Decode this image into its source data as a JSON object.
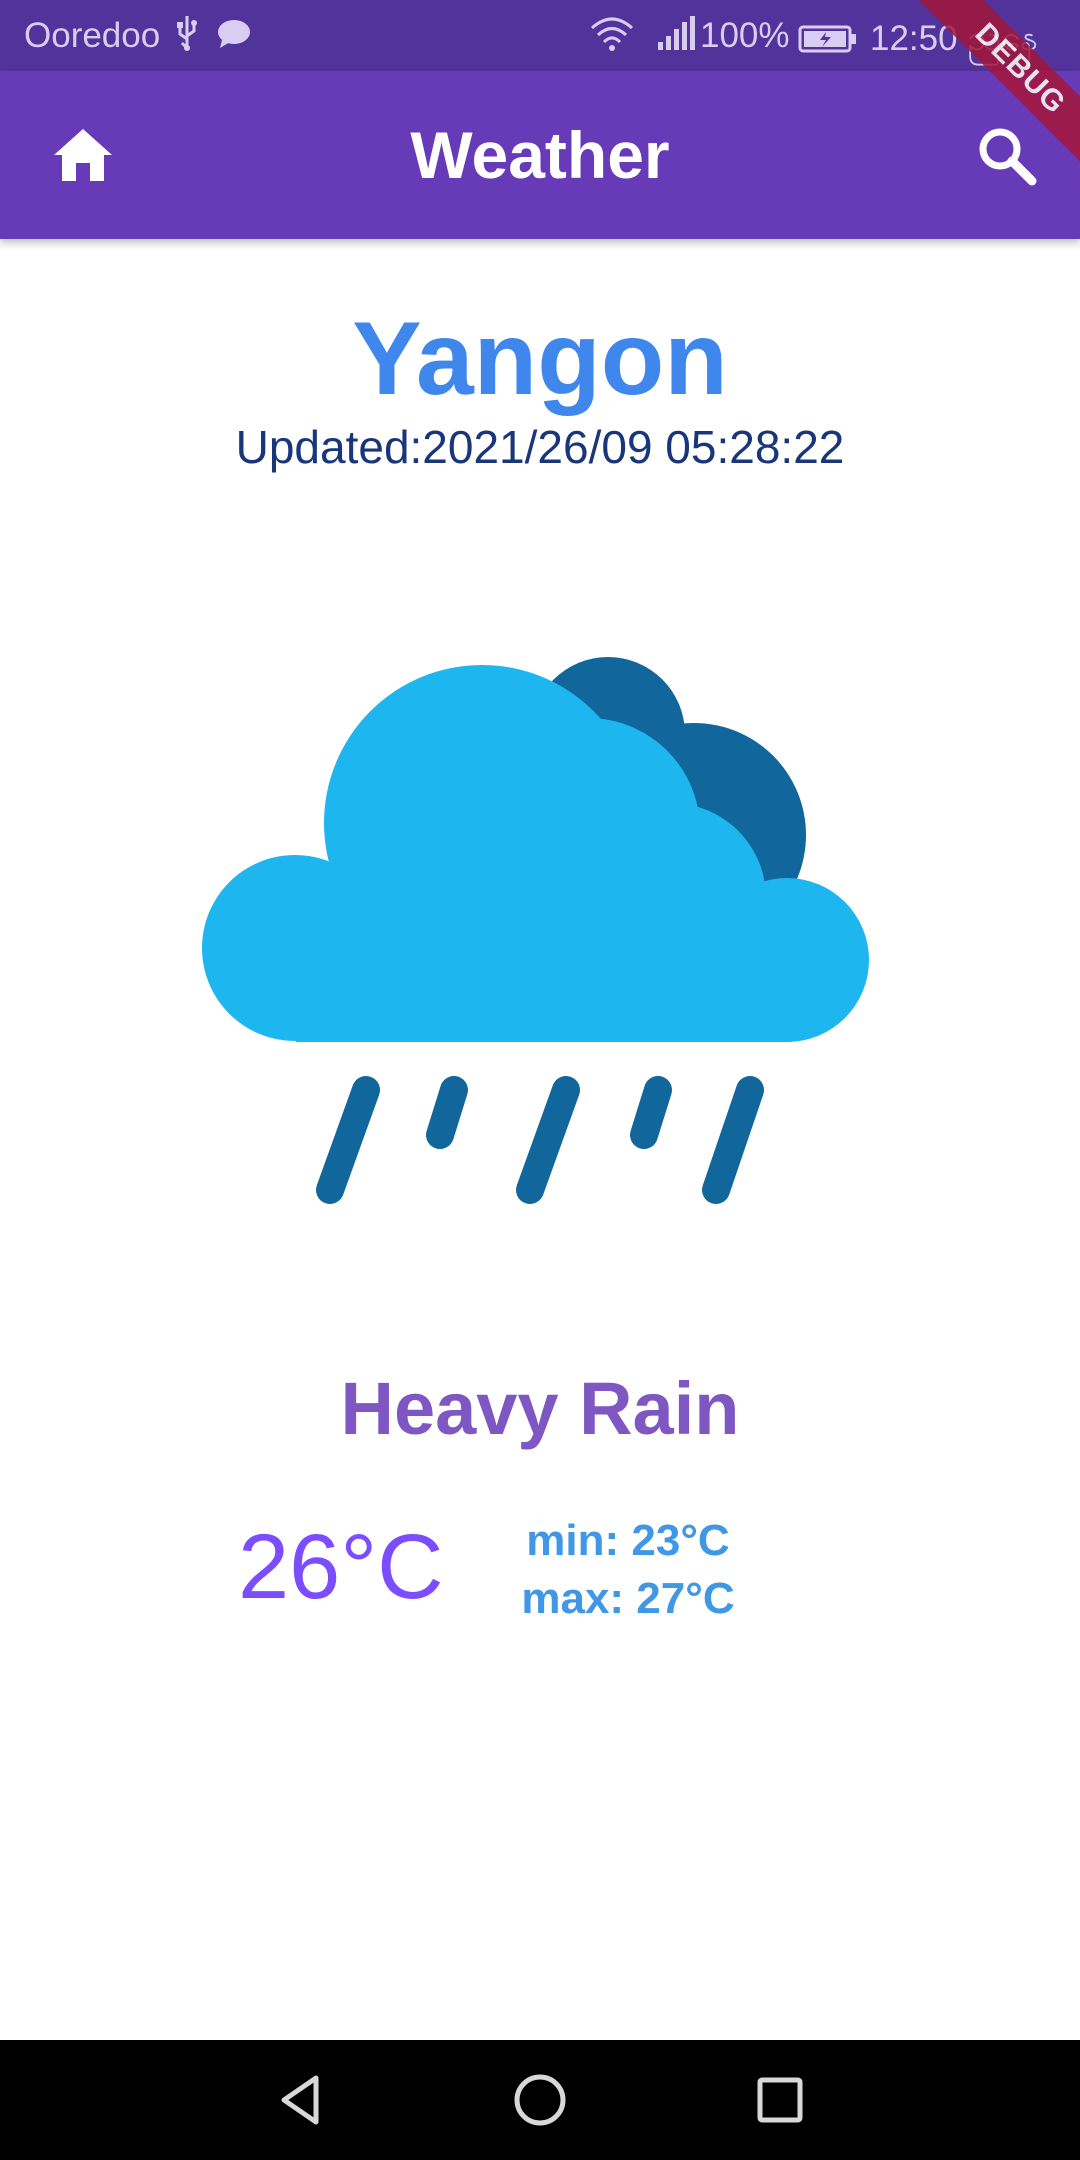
{
  "status_bar": {
    "carrier": "Ooredoo",
    "battery_percent": "100%",
    "time": "12:50 ညနေ"
  },
  "app_bar": {
    "title": "Weather",
    "home_icon": "home-icon",
    "search_icon": "search-icon",
    "color": "#673ab7"
  },
  "debug_banner": {
    "label": "DEBUG"
  },
  "weather": {
    "city": "Yangon",
    "updated": "Updated:2021/26/09 05:28:22",
    "condition": "Heavy Rain",
    "temperature": "26°C",
    "min": "min: 23°C",
    "max": "max: 27°C",
    "icon": "heavy-rain-cloud-icon"
  },
  "colors": {
    "city": "#3f87ed",
    "updated": "#19367a",
    "condition": "#7e57c2",
    "temperature": "#7c4dff",
    "minmax": "#3f97e6",
    "cloud_front": "#1eb6ee",
    "cloud_back": "#11669c"
  },
  "nav_bar": {
    "back_icon": "back-triangle-icon",
    "home_icon": "home-circle-icon",
    "recents_icon": "recents-square-icon"
  }
}
